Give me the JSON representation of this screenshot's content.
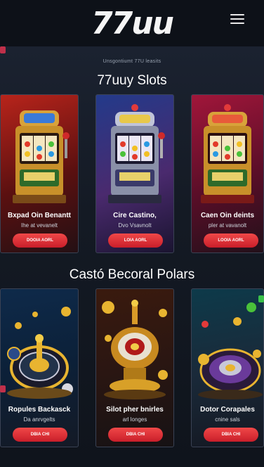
{
  "header": {
    "logo": "77uu",
    "menu_icon": "hamburger-menu-icon"
  },
  "kicker": "Unsgontiumt 77U leasits",
  "sections": [
    {
      "title": "77uuy Slots",
      "cards": [
        {
          "title": "Bxpad Oin Benantt",
          "subtitle": "Ihe at vevanelt",
          "cta": "DOOIA AORL",
          "art": "slot-machine-gold"
        },
        {
          "title": "Cire Castino,",
          "subtitle": "Dvo Vsavnolt",
          "cta": "LOIA AORL",
          "art": "slot-machine-blue"
        },
        {
          "title": "Caen Oin deints",
          "subtitle": "pler at vavanolt",
          "cta": "LOOIA AORL",
          "art": "slot-machine-red"
        }
      ]
    },
    {
      "title": "Castó Becoral Polars",
      "cards": [
        {
          "title": "Ropules Backasck",
          "subtitle": "Da anrvgelts",
          "cta": "DBIA CHI",
          "art": "roulette-wheel"
        },
        {
          "title": "Silot pher bnirles",
          "subtitle": "arl longes",
          "cta": "DBIA CHI",
          "art": "gold-trophy"
        },
        {
          "title": "Dotor Corapales",
          "subtitle": "cnine sals",
          "cta": "DBIA CHI",
          "art": "purple-roulette"
        }
      ]
    }
  ],
  "colors": {
    "background": "#0b0f17",
    "cta": "#e2333b",
    "card_border": "#3a4254"
  }
}
